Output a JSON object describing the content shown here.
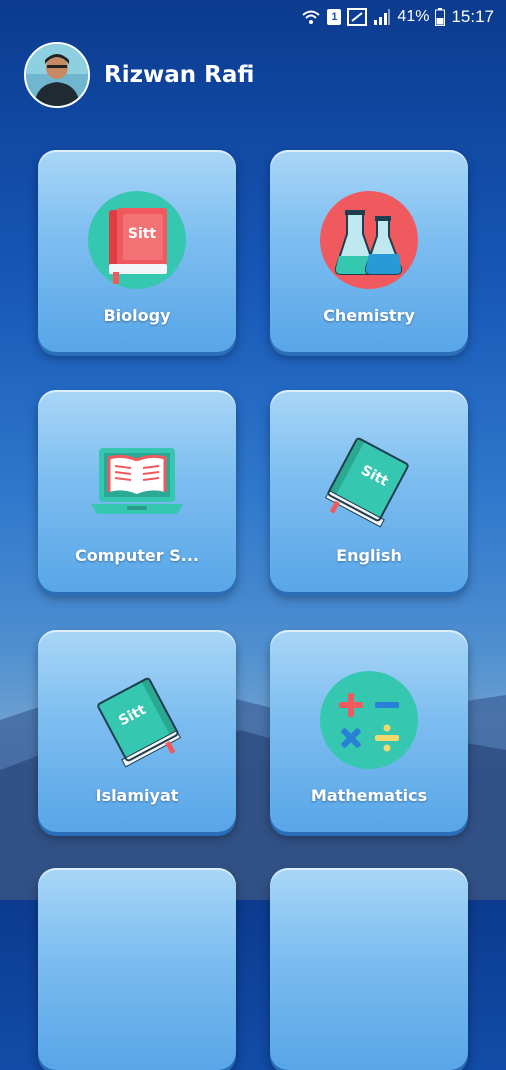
{
  "status_bar": {
    "battery_percent": "41%",
    "time": "15:17",
    "sim_badge": "1",
    "icons": [
      "wifi-calling-icon",
      "sim1-icon",
      "nfc-icon",
      "signal-icon",
      "battery-icon"
    ]
  },
  "profile": {
    "name": "Rizwan Rafi"
  },
  "subjects": [
    {
      "label": "Biology",
      "icon": "book-icon",
      "badge_text": "Sitt"
    },
    {
      "label": "Chemistry",
      "icon": "flasks-icon"
    },
    {
      "label": "Computer S...",
      "icon": "laptop-book-icon"
    },
    {
      "label": "English",
      "icon": "book-icon",
      "badge_text": "Sitt"
    },
    {
      "label": "Islamiyat",
      "icon": "book-icon",
      "badge_text": "Sitt"
    },
    {
      "label": "Mathematics",
      "icon": "math-symbols-icon"
    }
  ],
  "colors": {
    "tile_top": "#a9d6f7",
    "tile_bottom": "#58a6e8",
    "teal": "#36c7b0",
    "red": "#f05a5e"
  }
}
